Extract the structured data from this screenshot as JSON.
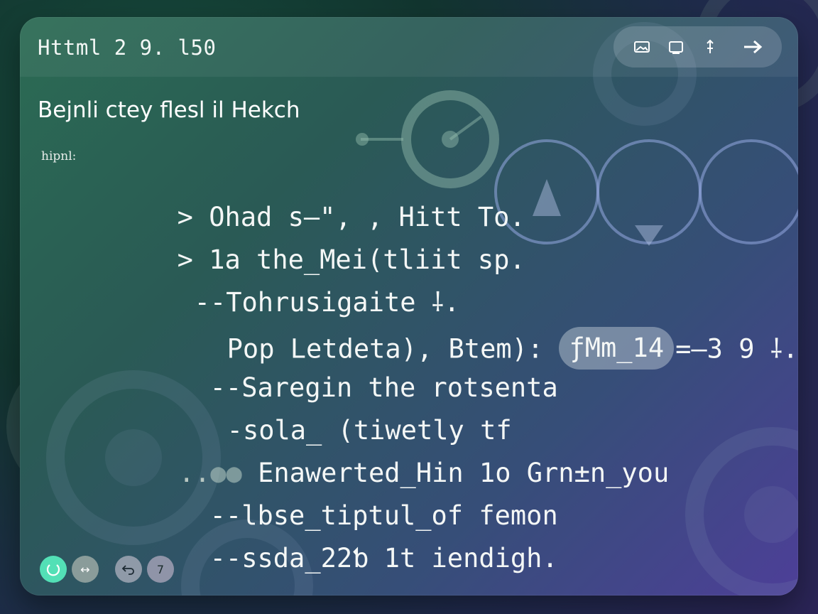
{
  "window": {
    "title": "Httml 2 9. l50"
  },
  "toolbar": {
    "buttons": [
      {
        "icon": "image-icon"
      },
      {
        "icon": "frame-icon"
      },
      {
        "icon": "resize-vertical-icon"
      },
      {
        "icon": "arrow-right-icon"
      }
    ]
  },
  "main": {
    "subtitle": "Bejnli ctey flesl il Hekch",
    "label": "hipnl:",
    "lines": [
      {
        "prefix": "> ",
        "text": "Ohad s–\", , Hitt To."
      },
      {
        "prefix": "> ",
        "text": "1a the_Mei(tliit sp."
      },
      {
        "prefix": "--",
        "text": "Tohrusigaite ⸸."
      },
      {
        "prefix": "",
        "text": "Pop Letdeta), Btem): ",
        "token": "ƒMm_14",
        "suffix": "=–3 9 ⸸."
      },
      {
        "prefix": "--",
        "text": "Saregin the rotsenta"
      },
      {
        "prefix": "-",
        "text": "sola_ (tiwetly tf"
      },
      {
        "prefix": "..",
        "text": "Enawerted_Hin 1o Grn±n_you"
      },
      {
        "prefix": "--",
        "text": "lbse_tiptul_of femon"
      },
      {
        "prefix": "--",
        "text": "ssda_22ƅ 1t iendigh."
      }
    ]
  },
  "footer": {
    "buttons": [
      {
        "icon": "refresh-icon",
        "label": "",
        "color": "#53e0b6"
      },
      {
        "icon": "swap-icon",
        "label": "↔",
        "color": "#8a9c9a"
      },
      {
        "icon": "undo-icon",
        "label": "",
        "color": "#8f9aa8"
      },
      {
        "icon": "help-icon",
        "label": "7",
        "color": "#8f94a8"
      }
    ]
  },
  "colors": {
    "accent": "#53e0b6",
    "card_start": "#2b6b53",
    "card_end": "#4d3f98"
  }
}
